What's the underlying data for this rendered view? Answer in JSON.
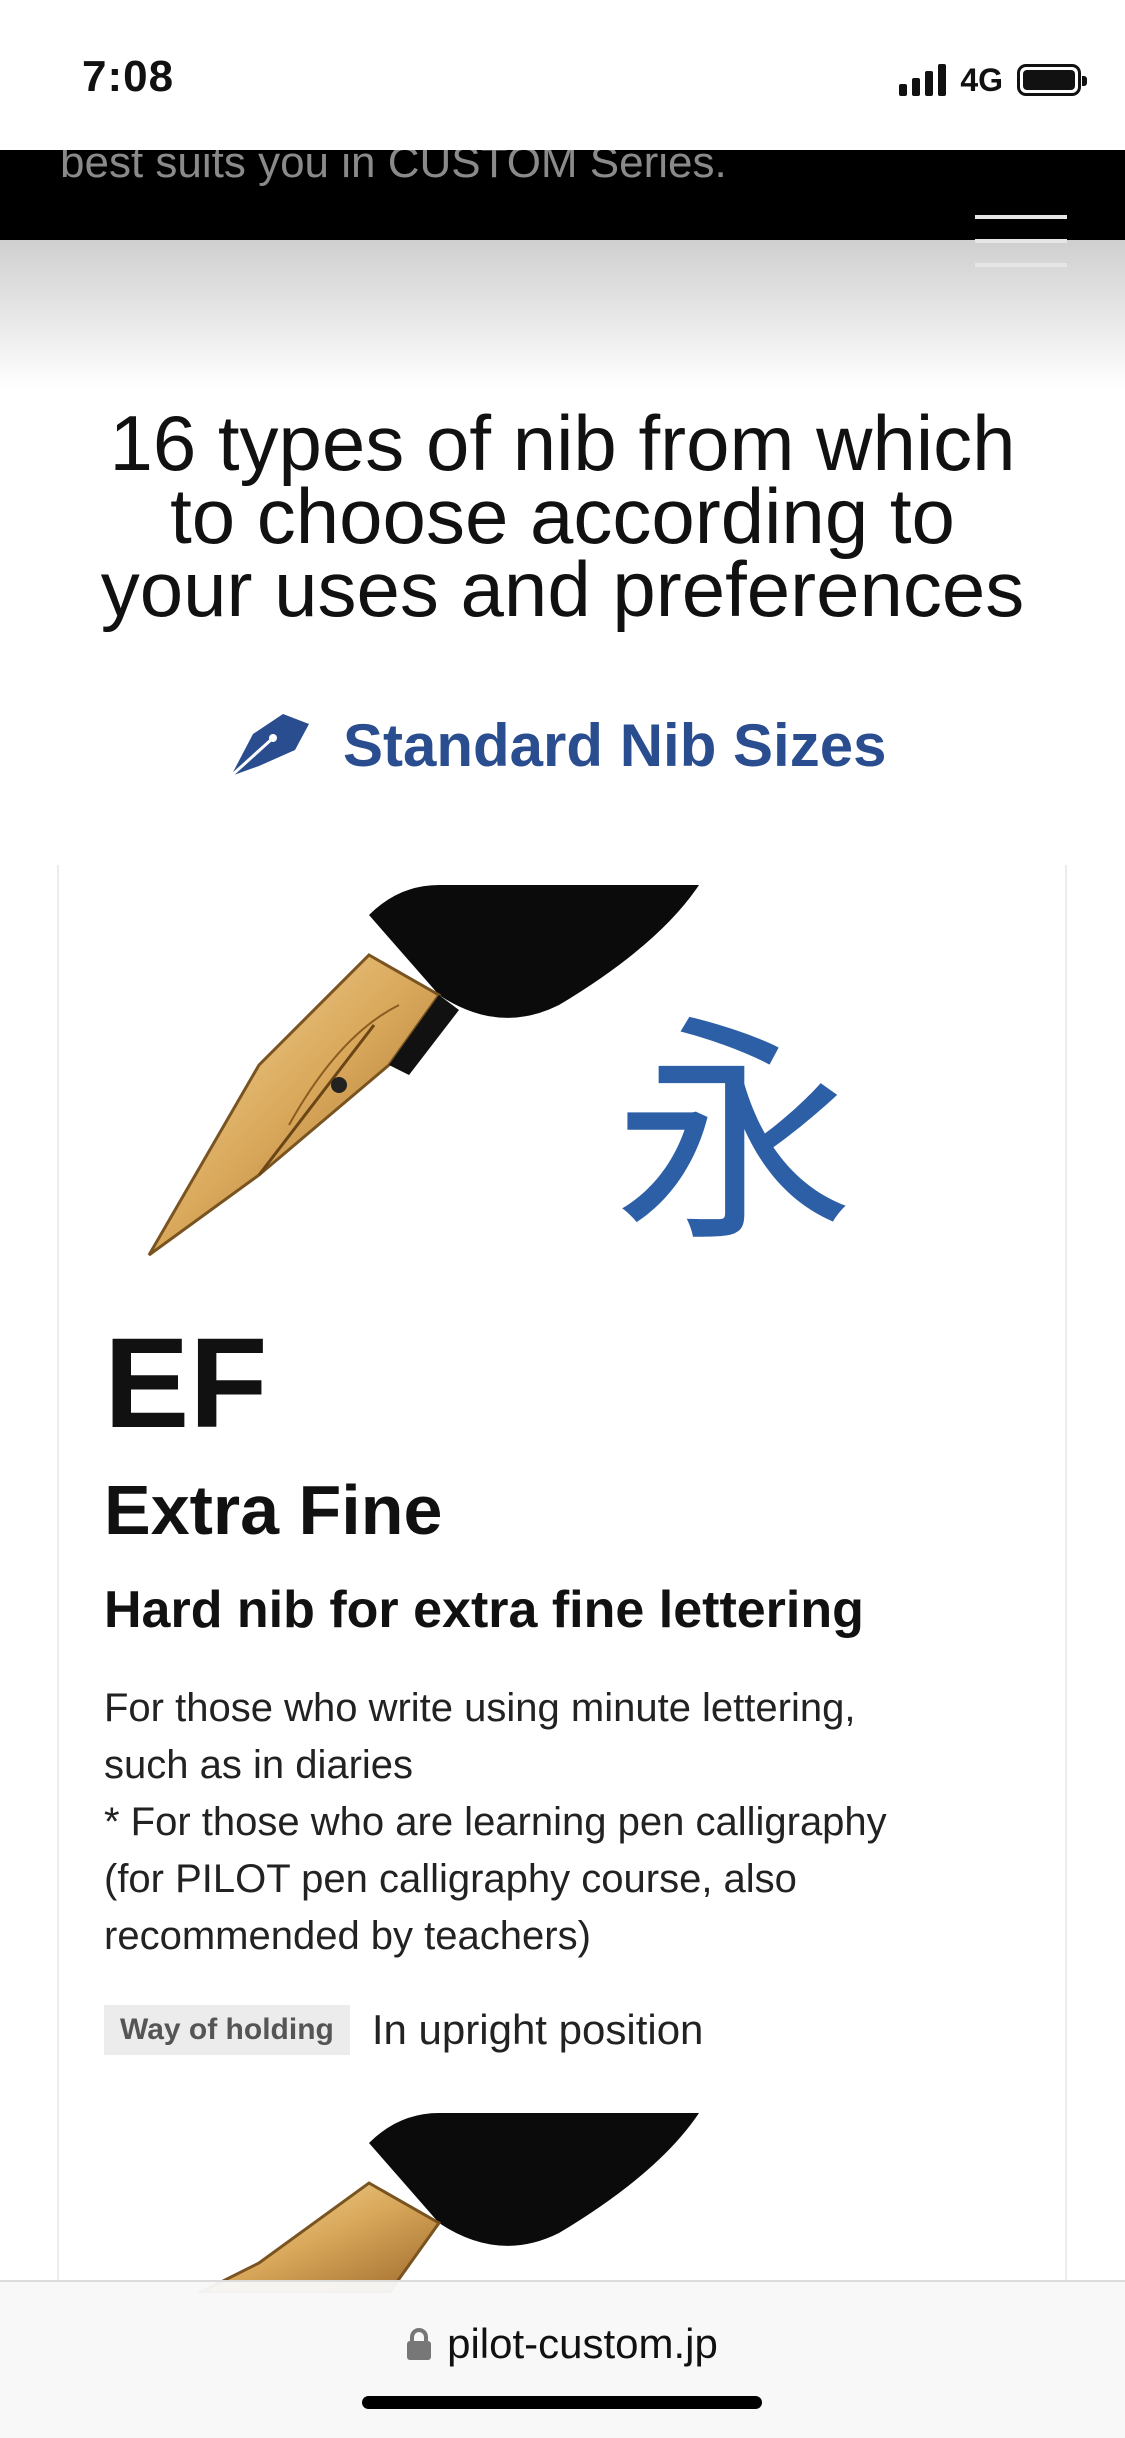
{
  "status": {
    "time": "7:08",
    "network": "4G"
  },
  "header": {
    "band_text": "best suits you in CUSTOM Series.",
    "menu_icon": "hamburger-menu-icon"
  },
  "headline": {
    "line1": "16 types of nib from which",
    "line2": "to choose according to",
    "line3": "your uses and preferences"
  },
  "section": {
    "title": "Standard Nib Sizes",
    "icon": "fountain-pen-nib-icon"
  },
  "nib_card": {
    "code": "EF",
    "name": "Extra Fine",
    "tagline": "Hard nib for extra fine lettering",
    "description": [
      "For those who write using minute lettering,",
      "such as in diaries",
      "* For those who are learning pen calligraphy",
      "(for PILOT pen calligraphy course, also",
      "recommended by teachers)"
    ],
    "holding_label": "Way of holding",
    "holding_value": "In upright position",
    "sample_character": "永"
  },
  "browser": {
    "url": "pilot-custom.jp",
    "lock_icon": "lock-icon"
  },
  "colors": {
    "accent_blue": "#2a4d8f",
    "ink_blue": "#2d5fa7",
    "badge_bg": "#ececec"
  }
}
